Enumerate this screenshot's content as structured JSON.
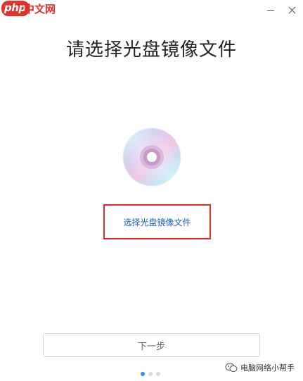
{
  "header": {
    "logo_php": "php",
    "logo_cn": "中文网"
  },
  "main": {
    "title": "请选择光盘镜像文件",
    "select_link": "选择光盘镜像文件",
    "next_button": "下一步"
  },
  "pagination": {
    "total": 3,
    "current": 1
  },
  "watermark": {
    "text": "电脑网络小帮手"
  },
  "colors": {
    "accent": "#2d8fe0",
    "highlight_border": "#e0312c",
    "link": "#1e63b8"
  },
  "icons": {
    "disc": "disc-icon",
    "minimize": "minimize-icon",
    "close": "close-icon",
    "wechat": "wechat-icon"
  }
}
